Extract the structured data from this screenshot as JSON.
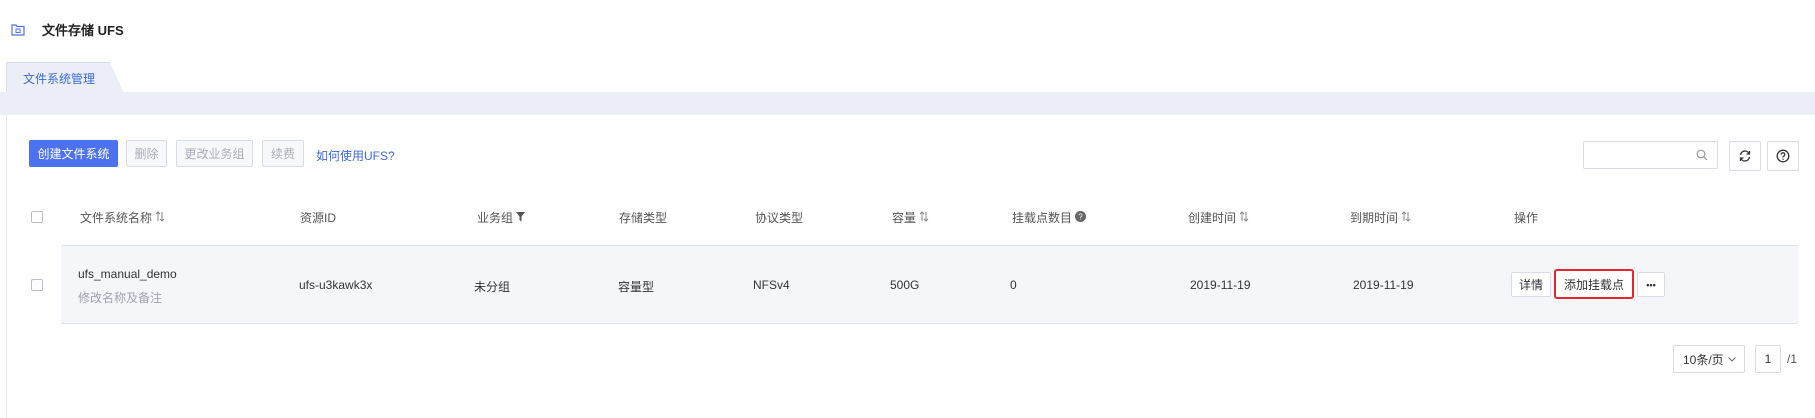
{
  "header": {
    "title": "文件存储 UFS"
  },
  "tabs": [
    {
      "label": "文件系统管理"
    }
  ],
  "toolbar": {
    "create_label": "创建文件系统",
    "delete_label": "删除",
    "change_group_label": "更改业务组",
    "renew_label": "续费",
    "help_link": "如何使用UFS?",
    "search_placeholder": ""
  },
  "table": {
    "columns": {
      "name": "文件系统名称",
      "resource_id": "资源ID",
      "group": "业务组",
      "storage_type": "存储类型",
      "protocol": "协议类型",
      "capacity": "容量",
      "mount_count": "挂载点数目",
      "created": "创建时间",
      "expires": "到期时间",
      "actions": "操作"
    },
    "rows": [
      {
        "name": "ufs_manual_demo",
        "edit_hint": "修改名称及备注",
        "resource_id": "ufs-u3kawk3x",
        "group": "未分组",
        "storage_type": "容量型",
        "protocol": "NFSv4",
        "capacity": "500G",
        "mount_count": "0",
        "created": "2019-11-19",
        "expires": "2019-11-19",
        "actions": {
          "detail": "详情",
          "add_mount": "添加挂载点",
          "more": "•••"
        }
      }
    ]
  },
  "pagination": {
    "page_size": "10条/页",
    "current_page": "1",
    "total": "/1"
  },
  "colors": {
    "primary": "#4d72f0",
    "link": "#3d6bd8",
    "highlight": "#e5262f"
  }
}
